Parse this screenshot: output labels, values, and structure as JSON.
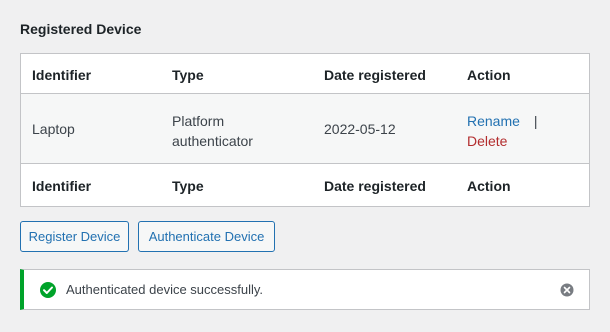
{
  "section": {
    "title": "Registered Device"
  },
  "table": {
    "headers": [
      "Identifier",
      "Type",
      "Date registered",
      "Action"
    ],
    "rows": [
      {
        "identifier": "Laptop",
        "type_line1": "Platform",
        "type_line2": "authenticator",
        "date": "2022-05-12",
        "rename_label": "Rename",
        "separator": "|",
        "delete_label": "Delete"
      }
    ]
  },
  "buttons": {
    "register_label": "Register Device",
    "authenticate_label": "Authenticate Device"
  },
  "notice": {
    "message": "Authenticated device successfully.",
    "status_icon": "check-circle-icon",
    "dismiss_icon": "dismiss-icon"
  },
  "colors": {
    "accent": "#2271b1",
    "danger": "#b32d2e",
    "success": "#00a32a"
  }
}
